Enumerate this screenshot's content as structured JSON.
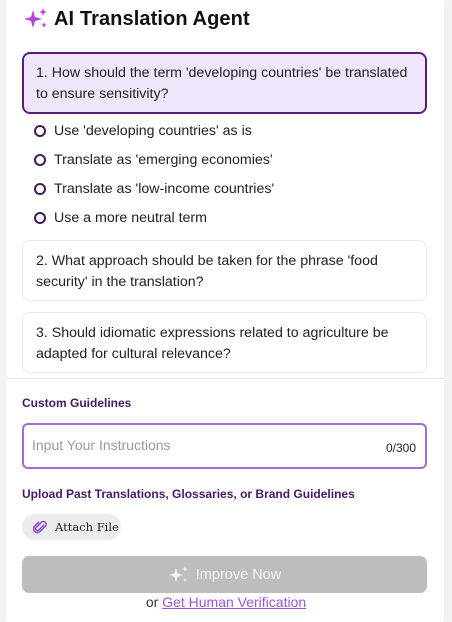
{
  "app": {
    "title": "AI Translation Agent"
  },
  "questions": [
    {
      "text": "1. How should the term 'developing countries' be translated to ensure sensitivity?"
    },
    {
      "text": "2. What approach should be taken for the phrase 'food security' in the translation?"
    },
    {
      "text": "3. Should idiomatic expressions related to agriculture be adapted for cultural relevance?"
    }
  ],
  "options": [
    {
      "label": "Use 'developing countries' as is"
    },
    {
      "label": "Translate as 'emerging economies'"
    },
    {
      "label": "Translate as 'low-income countries'"
    },
    {
      "label": "Use a more neutral term"
    }
  ],
  "guidelines": {
    "label": "Custom Guidelines",
    "placeholder": "Input Your Instructions",
    "value": "",
    "counter": "0/300"
  },
  "upload": {
    "label": "Upload Past Translations, Glossaries, or Brand Guidelines",
    "button_label": "Attach File"
  },
  "actions": {
    "improve_label": "Improve Now",
    "or_text": "or",
    "verify_link": "Get Human Verification"
  },
  "colors": {
    "accent": "#5a1e78",
    "active_card_bg": "#efe6fb",
    "input_border": "#a46ad0",
    "disabled_button": "#bdbdbd",
    "link": "#9b55d0"
  }
}
